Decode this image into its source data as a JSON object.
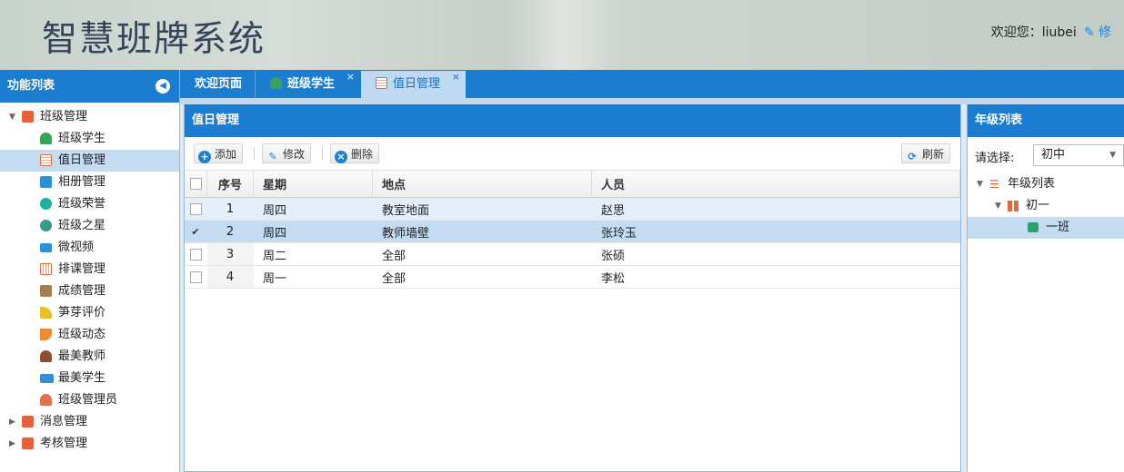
{
  "header": {
    "title": "智慧班牌系统",
    "welcome": "欢迎您：liubei",
    "edit_label": "修"
  },
  "left_panel": {
    "title": "功能列表",
    "tree": [
      {
        "label": "班级管理",
        "icon": "folder-icon",
        "color": "#e6603a"
      },
      {
        "label": "班级学生",
        "icon": "user-icon",
        "color": "#3aa35a"
      },
      {
        "label": "值日管理",
        "icon": "calendar-icon",
        "color": "#e36c3c"
      },
      {
        "label": "相册管理",
        "icon": "photo-icon",
        "color": "#2d8fd6"
      },
      {
        "label": "班级荣誉",
        "icon": "medal-icon",
        "color": "#1fb0a0"
      },
      {
        "label": "班级之星",
        "icon": "star-icon",
        "color": "#3a9a8a"
      },
      {
        "label": "微视频",
        "icon": "video-icon",
        "color": "#2d8fd6"
      },
      {
        "label": "排课管理",
        "icon": "schedule-icon",
        "color": "#e06a3a"
      },
      {
        "label": "成绩管理",
        "icon": "grades-icon",
        "color": "#a08050"
      },
      {
        "label": "笋芽评价",
        "icon": "bamboo-icon",
        "color": "#e8c020"
      },
      {
        "label": "班级动态",
        "icon": "flag-icon",
        "color": "#f08a30"
      },
      {
        "label": "最美教师",
        "icon": "teacher-icon",
        "color": "#8a5030"
      },
      {
        "label": "最美学生",
        "icon": "card-icon",
        "color": "#3a8ad0"
      },
      {
        "label": "班级管理员",
        "icon": "admin-icon",
        "color": "#e07050"
      },
      {
        "label": "消息管理",
        "icon": "folder-icon",
        "color": "#e6603a"
      },
      {
        "label": "考核管理",
        "icon": "folder-icon",
        "color": "#e6603a"
      }
    ]
  },
  "tabs": [
    {
      "label": "欢迎页面"
    },
    {
      "label": "班级学生",
      "close": "×"
    },
    {
      "label": "值日管理",
      "close": "×"
    }
  ],
  "center": {
    "title": "值日管理",
    "toolbar": {
      "add": "添加",
      "edit": "修改",
      "delete": "删除",
      "refresh": "刷新"
    },
    "columns": [
      "序号",
      "星期",
      "地点",
      "人员"
    ],
    "rows": [
      {
        "no": "1",
        "day": "周四",
        "place": "教室地面",
        "person": "赵思",
        "checked": false
      },
      {
        "no": "2",
        "day": "周四",
        "place": "教师墙壁",
        "person": "张玲玉",
        "checked": true
      },
      {
        "no": "3",
        "day": "周二",
        "place": "全部",
        "person": "张硕",
        "checked": false
      },
      {
        "no": "4",
        "day": "周一",
        "place": "全部",
        "person": "李松",
        "checked": false
      }
    ]
  },
  "right_panel": {
    "title": "年级列表",
    "select_label": "请选择:",
    "select_value": "初中",
    "tree": [
      {
        "label": "年级列表"
      },
      {
        "label": "初一"
      },
      {
        "label": "一班"
      }
    ]
  }
}
